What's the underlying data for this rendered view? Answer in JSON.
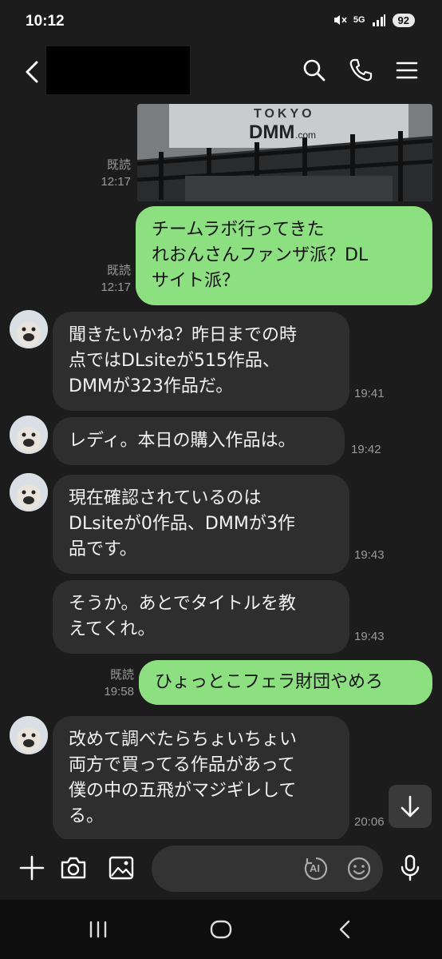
{
  "status": {
    "time": "10:12",
    "network": "5G",
    "battery": "92"
  },
  "header": {
    "contact_name_redacted": true
  },
  "photo": {
    "sign_top": "TOKYO",
    "sign_main": "DMM",
    "sign_suffix": ".com"
  },
  "messages": [
    {
      "read_label": "既読",
      "time": "12:17"
    },
    {
      "read_label": "既読",
      "time": "12:17",
      "text": "チームラボ行ってきた\nれおんさんファンザ派？DL\nサイト派？"
    },
    {
      "text": "聞きたいかね？昨日までの時\n点ではDLsiteが515作品、\nDMMが323作品だ。",
      "time": "19:41"
    },
    {
      "text": "レディ。本日の購入作品は。",
      "time": "19:42"
    },
    {
      "text": "現在確認されているのは\nDLsiteが0作品、DMMが3作\n品です。",
      "time": "19:43"
    },
    {
      "text": "そうか。あとでタイトルを教\nえてくれ。",
      "time": "19:43"
    },
    {
      "read_label": "既読",
      "time": "19:58",
      "text": "ひょっとこフェラ財団やめろ"
    },
    {
      "text": "改めて調べたらちょいちょい\n両方で買ってる作品があって\n僕の中の五飛がマジギレして\nる。",
      "time": "20:06"
    }
  ],
  "composer": {
    "ai_label": "AI"
  },
  "colors": {
    "outgoing_bubble": "#8de07f",
    "incoming_bubble": "#2e2e2e",
    "background": "#1c1c1c"
  }
}
